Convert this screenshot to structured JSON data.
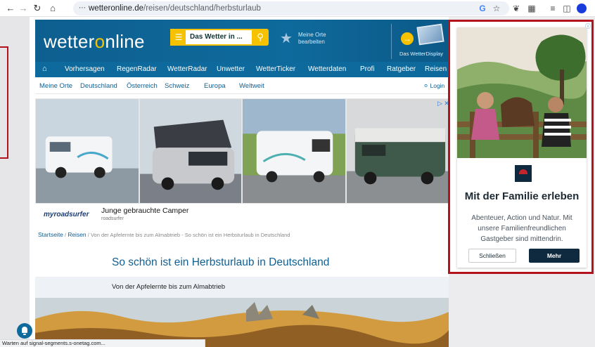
{
  "browser": {
    "url_host": "wetteronline.de",
    "url_path": "/reisen/deutschland/herbsturlaub"
  },
  "site": {
    "logo_text_1": "wetter",
    "logo_o": "o",
    "logo_text_2": "nline",
    "search_placeholder": "Das Wetter in ...",
    "meine_orte_label": "Meine Orte bearbeiten",
    "wetterdisplay_label": "Das WetterDisplay"
  },
  "main_nav": [
    "Vorhersagen",
    "RegenRadar",
    "WetterRadar",
    "Unwetter",
    "WetterTicker",
    "Wetterdaten",
    "Profi",
    "Ratgeber",
    "Reisen"
  ],
  "sub_nav": [
    "Meine Orte",
    "Deutschland",
    "Österreich",
    "Schweiz",
    "Europa",
    "Weltweit"
  ],
  "login_label": "Login",
  "ad_strip": {
    "logo": "myroadsurfer",
    "headline": "Junge gebrauchte Camper",
    "advertiser": "roadsurfer"
  },
  "breadcrumb": {
    "home": "Startseite",
    "section": "Reisen",
    "current": "Von der Apfelernte bis zum Almabtrieb - So schön ist ein Herbsturlaub in Deutschland",
    "separator": "/"
  },
  "article": {
    "title": "So schön ist ein Herbsturlaub in Deutschland",
    "subtitle": "Von der Apfelernte bis zum Almabtrieb"
  },
  "side_ad": {
    "heading": "Mit der Familie erleben",
    "body": "Abenteuer, Action und Natur. Mit unsere Familienfreundlichen Gastgeber sind mittendrin.",
    "close_label": "Schließen",
    "more_label": "Mehr"
  },
  "status_bar": "Warten auf signal-segments.s-onetag.com...",
  "colors": {
    "brand_blue": "#0e6a9c",
    "brand_yellow": "#f6c200",
    "highlight_red": "#b3121f"
  }
}
